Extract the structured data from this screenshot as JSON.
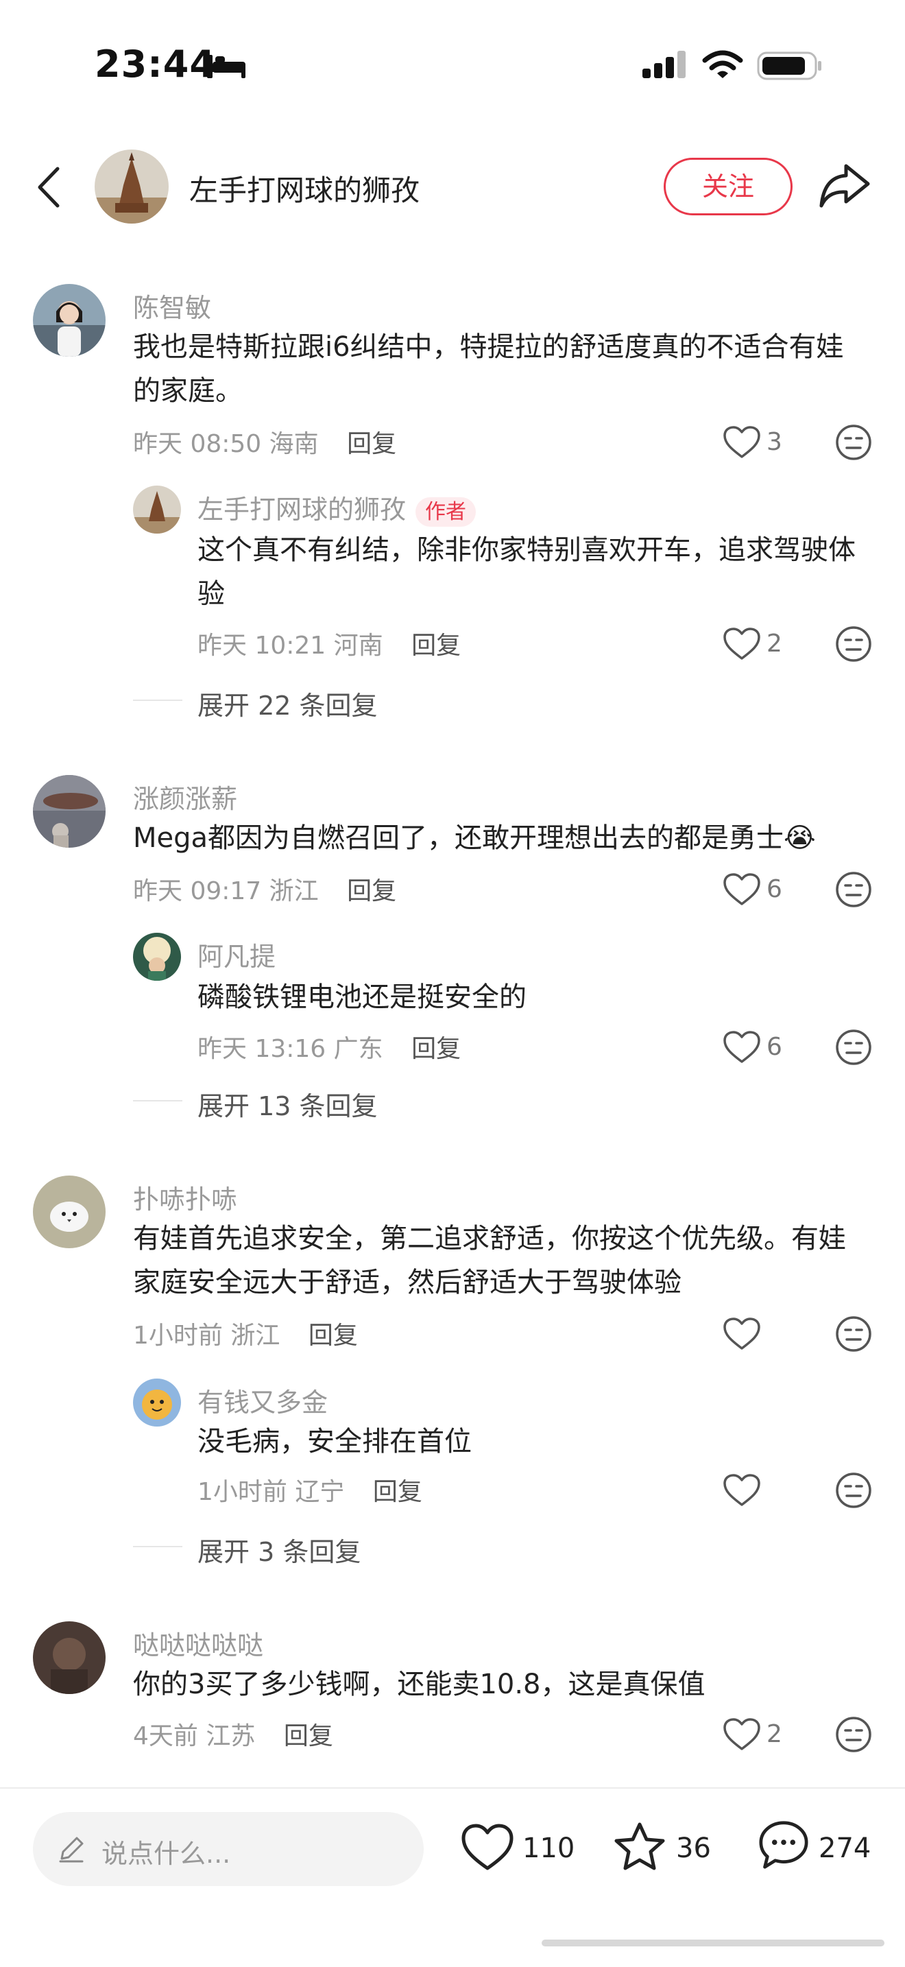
{
  "status_bar": {
    "time": "23:44"
  },
  "header": {
    "title": "左手打网球的狮孜",
    "follow_label": "关注"
  },
  "comments": [
    {
      "user": "陈智敏",
      "text": "我也是特斯拉跟i6纠结中，特提拉的舒适度真的不适合有娃的家庭。",
      "time": "昨天 08:50",
      "location": "海南",
      "reply_label": "回复",
      "likes": "3",
      "reply": {
        "user": "左手打网球的狮孜",
        "author_tag": "作者",
        "text": "这个真不有纠结，除非你家特别喜欢开车，追求驾驶体验",
        "time": "昨天 10:21",
        "location": "河南",
        "reply_label": "回复",
        "likes": "2"
      },
      "expand": "展开 22 条回复"
    },
    {
      "user": "涨颜涨薪",
      "text": "Mega都因为自燃召回了，还敢开理想出去的都是勇士😭",
      "time": "昨天 09:17",
      "location": "浙江",
      "reply_label": "回复",
      "likes": "6",
      "reply": {
        "user": "阿凡提",
        "text": "磷酸铁锂电池还是挺安全的",
        "time": "昨天 13:16",
        "location": "广东",
        "reply_label": "回复",
        "likes": "6"
      },
      "expand": "展开 13 条回复"
    },
    {
      "user": "扑哧扑哧",
      "text": "有娃首先追求安全，第二追求舒适，你按这个优先级。有娃家庭安全远大于舒适，然后舒适大于驾驶体验",
      "time": "1小时前",
      "location": "浙江",
      "reply_label": "回复",
      "likes": "",
      "reply": {
        "user": "有钱又多金",
        "text": "没毛病，安全排在首位",
        "time": "1小时前",
        "location": "辽宁",
        "reply_label": "回复",
        "likes": ""
      },
      "expand": "展开 3 条回复"
    },
    {
      "user": "哒哒哒哒哒",
      "text": "你的3买了多少钱啊，还能卖10.8，这是真保值",
      "time": "4天前",
      "location": "江苏",
      "reply_label": "回复",
      "likes": "2"
    }
  ],
  "bottom_bar": {
    "input_placeholder": "说点什么...",
    "likes": "110",
    "stars": "36",
    "comments": "274"
  },
  "colors": {
    "accent": "#e8384a",
    "muted": "#999999",
    "text": "#222222"
  },
  "icons": [
    "bed-icon",
    "signal-icon",
    "wifi-icon",
    "battery-icon",
    "back-icon",
    "share-icon",
    "heart-icon",
    "emoji-icon",
    "pencil-icon",
    "star-icon",
    "chat-icon"
  ]
}
